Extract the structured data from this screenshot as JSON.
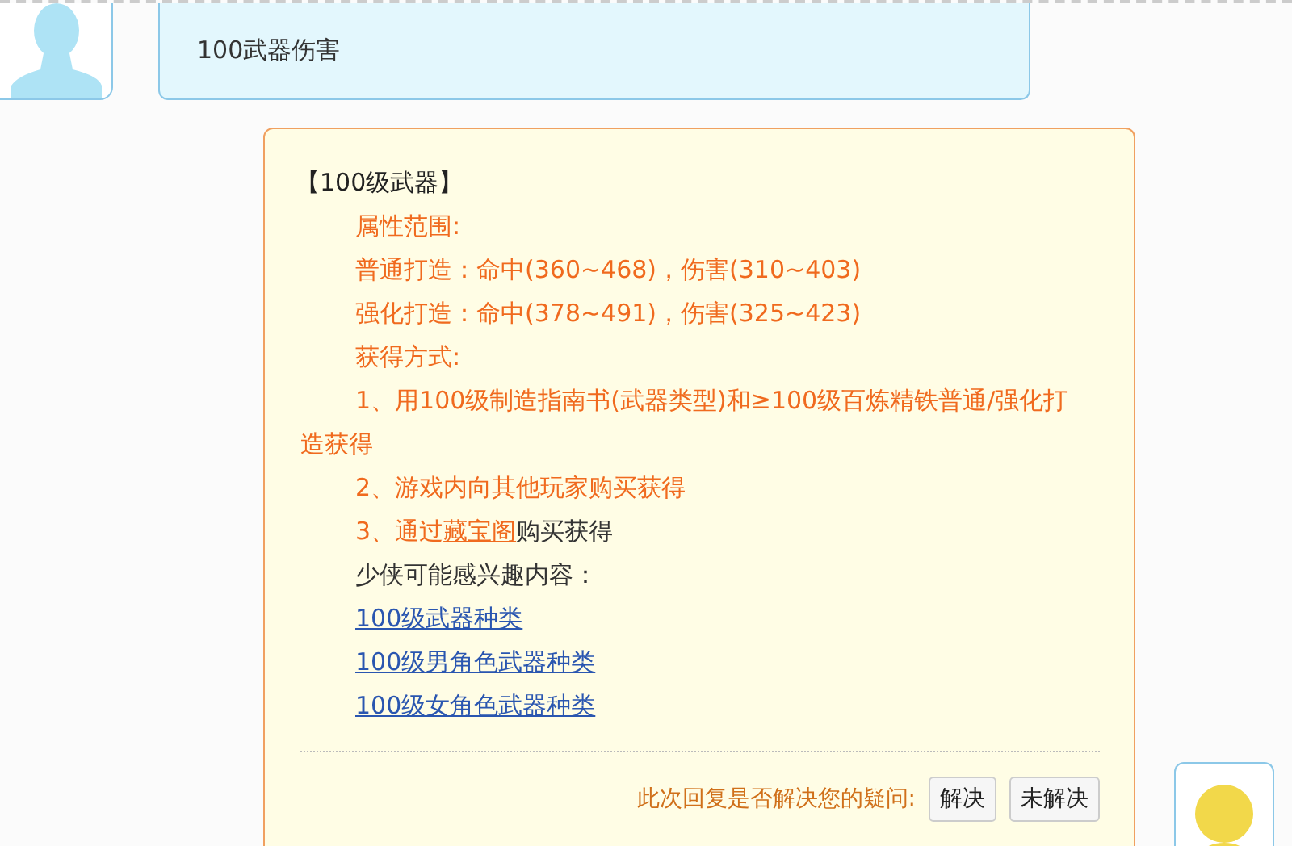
{
  "question": {
    "text": "100武器伤害"
  },
  "answer": {
    "title": "【100级武器】",
    "lines": [
      {
        "parts": [
          {
            "kind": "accent",
            "text": "属性范围:"
          }
        ]
      },
      {
        "parts": [
          {
            "kind": "accent",
            "text": "普通打造：命中(360~468)，伤害(310~403)"
          }
        ]
      },
      {
        "parts": [
          {
            "kind": "accent",
            "text": "强化打造：命中(378~491)，伤害(325~423)"
          }
        ]
      },
      {
        "parts": [
          {
            "kind": "accent",
            "text": "获得方式:"
          }
        ]
      },
      {
        "parts": [
          {
            "kind": "accent",
            "text": "1、用100级制造指南书(武器类型)和≥100级百炼精铁普通/强化打造获得"
          }
        ]
      },
      {
        "parts": [
          {
            "kind": "accent",
            "text": "2、游戏内向其他玩家购买获得"
          }
        ]
      },
      {
        "parts": [
          {
            "kind": "accent",
            "text": "3、通过"
          },
          {
            "kind": "accent-link",
            "text": "藏宝阁"
          },
          {
            "kind": "plain",
            "text": "购买获得"
          }
        ]
      },
      {
        "parts": [
          {
            "kind": "plain",
            "text": "少侠可能感兴趣内容："
          }
        ]
      },
      {
        "parts": [
          {
            "kind": "link",
            "text": "100级武器种类"
          }
        ]
      },
      {
        "parts": [
          {
            "kind": "link",
            "text": "100级男角色武器种类"
          }
        ]
      },
      {
        "parts": [
          {
            "kind": "link",
            "text": "100级女角色武器种类"
          }
        ]
      }
    ]
  },
  "feedback": {
    "prompt": "此次回复是否解决您的疑问:",
    "buttons": [
      "解决",
      "未解决"
    ]
  }
}
